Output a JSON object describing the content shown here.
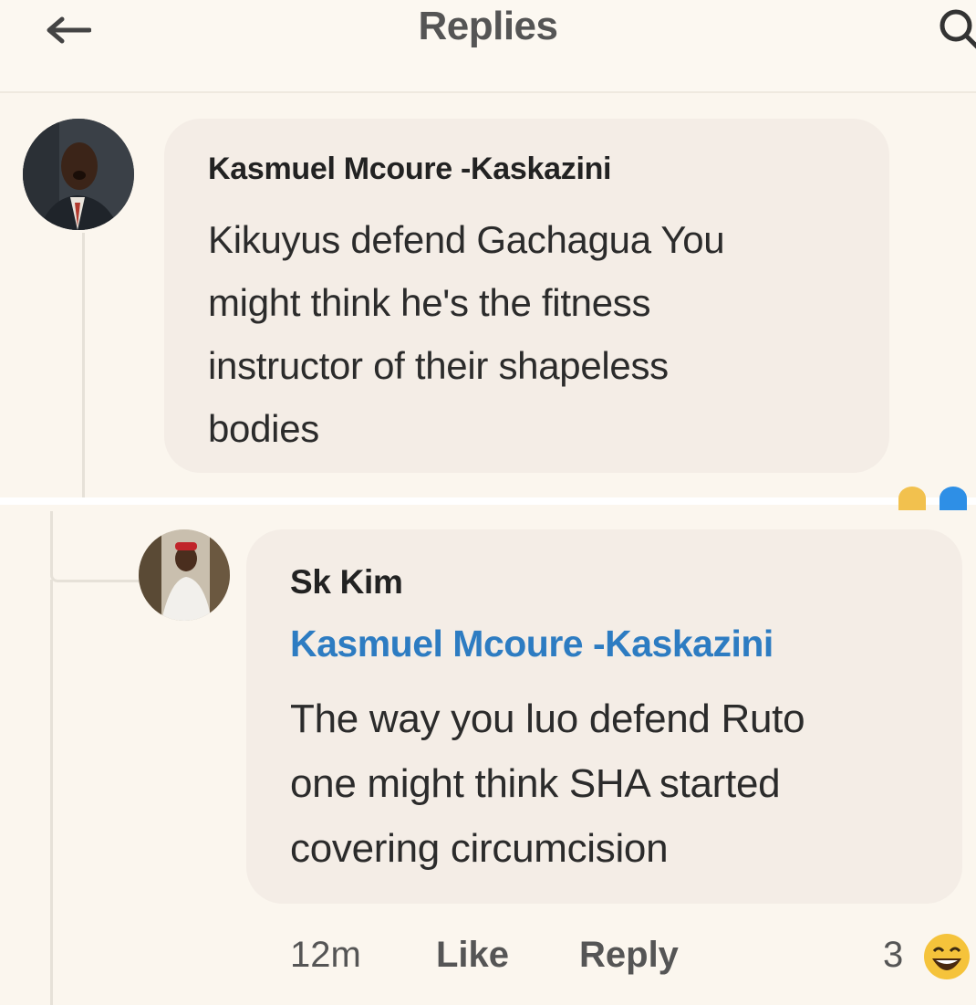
{
  "header": {
    "title": "Replies",
    "back_icon": "arrow-left-icon",
    "search_icon": "search-icon"
  },
  "comment": {
    "author": "Kasmuel Mcoure -Kaskazini",
    "text": "Kikuyus defend Gachagua You\nmight think he's the fitness\ninstructor of their shapeless\nbodies"
  },
  "reply": {
    "author": "Sk Kim",
    "mention": "Kasmuel Mcoure -Kaskazini",
    "text": "The way you luo defend Ruto\none might think SHA started\ncovering circumcision",
    "time": "12m",
    "like_label": "Like",
    "reply_label": "Reply",
    "reaction_count": "3",
    "reaction_icon": "haha-emoji-icon"
  },
  "colors": {
    "background": "#fbf6ee",
    "bubble": "#f4ede6",
    "mention": "#2d7cc2"
  }
}
